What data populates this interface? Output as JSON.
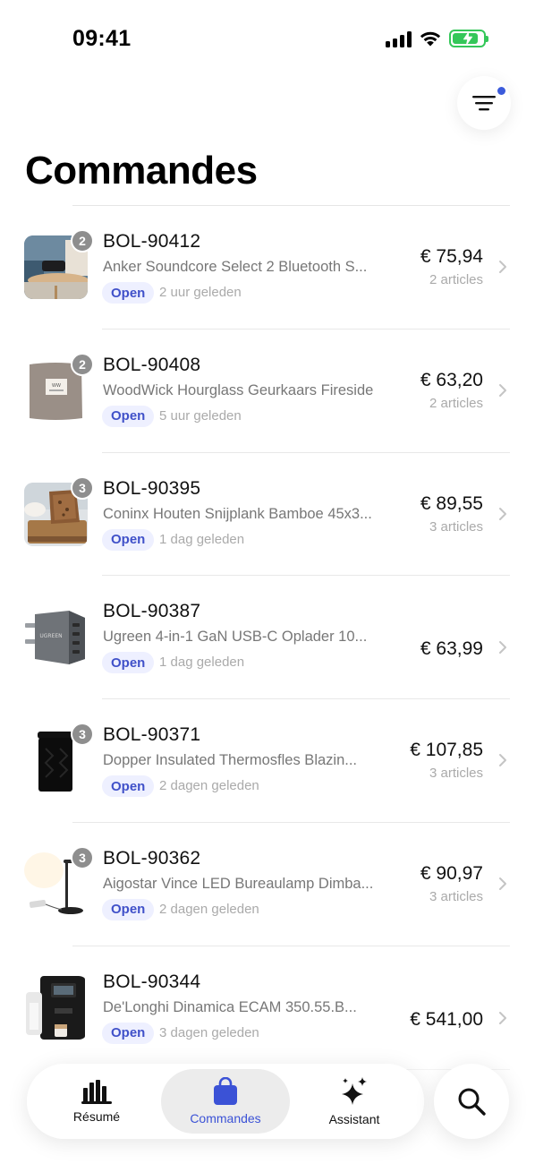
{
  "status_bar": {
    "time": "09:41",
    "icons": [
      "signal-icon",
      "wifi-icon",
      "battery-charging-icon"
    ],
    "battery_level": 0.85
  },
  "header": {
    "title": "Commandes",
    "filter_icon": "filter-icon",
    "filter_active": true
  },
  "orders": [
    {
      "id": "BOL-90412",
      "description": "Anker Soundcore Select 2 Bluetooth S...",
      "status": "Open",
      "time": "2 uur geleden",
      "price": "€ 75,94",
      "items": "2 articles",
      "count": "2",
      "thumb": "speaker"
    },
    {
      "id": "BOL-90408",
      "description": "WoodWick Hourglass Geurkaars Fireside",
      "status": "Open",
      "time": "5 uur geleden",
      "price": "€ 63,20",
      "items": "2 articles",
      "count": "2",
      "thumb": "candle"
    },
    {
      "id": "BOL-90395",
      "description": "Coninx Houten Snijplank Bamboe 45x3...",
      "status": "Open",
      "time": "1 dag geleden",
      "price": "€ 89,55",
      "items": "3 articles",
      "count": "3",
      "thumb": "board"
    },
    {
      "id": "BOL-90387",
      "description": "Ugreen 4-in-1 GaN USB-C Oplader 10...",
      "status": "Open",
      "time": "1 dag geleden",
      "price": "€ 63,99",
      "items": "",
      "count": "",
      "thumb": "charger"
    },
    {
      "id": "BOL-90371",
      "description": "Dopper Insulated Thermosfles Blazin...",
      "status": "Open",
      "time": "2 dagen geleden",
      "price": "€ 107,85",
      "items": "3 articles",
      "count": "3",
      "thumb": "bottle"
    },
    {
      "id": "BOL-90362",
      "description": "Aigostar Vince LED Bureaulamp Dimba...",
      "status": "Open",
      "time": "2 dagen geleden",
      "price": "€ 90,97",
      "items": "3 articles",
      "count": "3",
      "thumb": "lamp"
    },
    {
      "id": "BOL-90344",
      "description": "De'Longhi Dinamica ECAM 350.55.B...",
      "status": "Open",
      "time": "3 dagen geleden",
      "price": "€ 541,00",
      "items": "",
      "count": "",
      "thumb": "coffee"
    }
  ],
  "tab_bar": {
    "tabs": [
      {
        "label": "Résumé",
        "icon": "bar-chart-icon",
        "active": false
      },
      {
        "label": "Commandes",
        "icon": "shopping-bag-icon",
        "active": true
      },
      {
        "label": "Assistant",
        "icon": "sparkles-icon",
        "active": false
      }
    ],
    "search_icon": "search-icon"
  },
  "colors": {
    "accent": "#3b52d6",
    "pill_bg": "#eef0ff",
    "pill_text": "#4051c9",
    "battery": "#34c759",
    "badge": "#8e8e8e"
  }
}
